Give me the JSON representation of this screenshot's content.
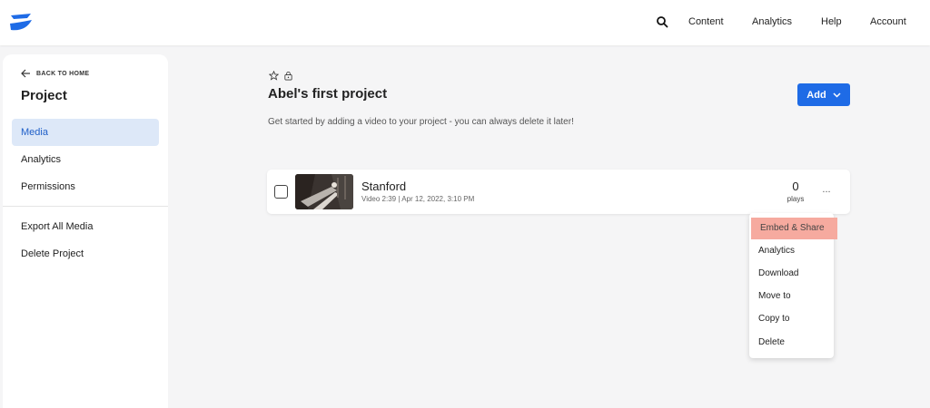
{
  "app": {
    "logo_icon": "wistia-logo-icon",
    "accent_color": "#1e6be6"
  },
  "topnav": {
    "search_icon": "search-icon",
    "items": [
      "Content",
      "Analytics",
      "Help",
      "Account"
    ]
  },
  "sidebar": {
    "back_label": "BACK TO HOME",
    "title": "Project",
    "items": [
      {
        "label": "Media",
        "active": true
      },
      {
        "label": "Analytics",
        "active": false
      },
      {
        "label": "Permissions",
        "active": false
      },
      {
        "label": "Export All Media",
        "active": false
      },
      {
        "label": "Delete Project",
        "active": false
      }
    ]
  },
  "project": {
    "icons": [
      "star-icon",
      "lock-icon"
    ],
    "title": "Abel's first project",
    "add_label": "Add",
    "subtitle": "Get started by adding a video to your project - you can always delete it later!"
  },
  "media": [
    {
      "title": "Stanford",
      "meta": "Video 2:39 | Apr 12, 2022, 3:10 PM",
      "plays_count": "0",
      "plays_label": "plays",
      "more_label": "..."
    }
  ],
  "context_menu": {
    "items": [
      "Embed & Share",
      "Analytics",
      "Download",
      "Move to",
      "Copy to",
      "Delete"
    ],
    "highlighted": "Embed & Share",
    "highlight_color": "#f6aa9f"
  }
}
